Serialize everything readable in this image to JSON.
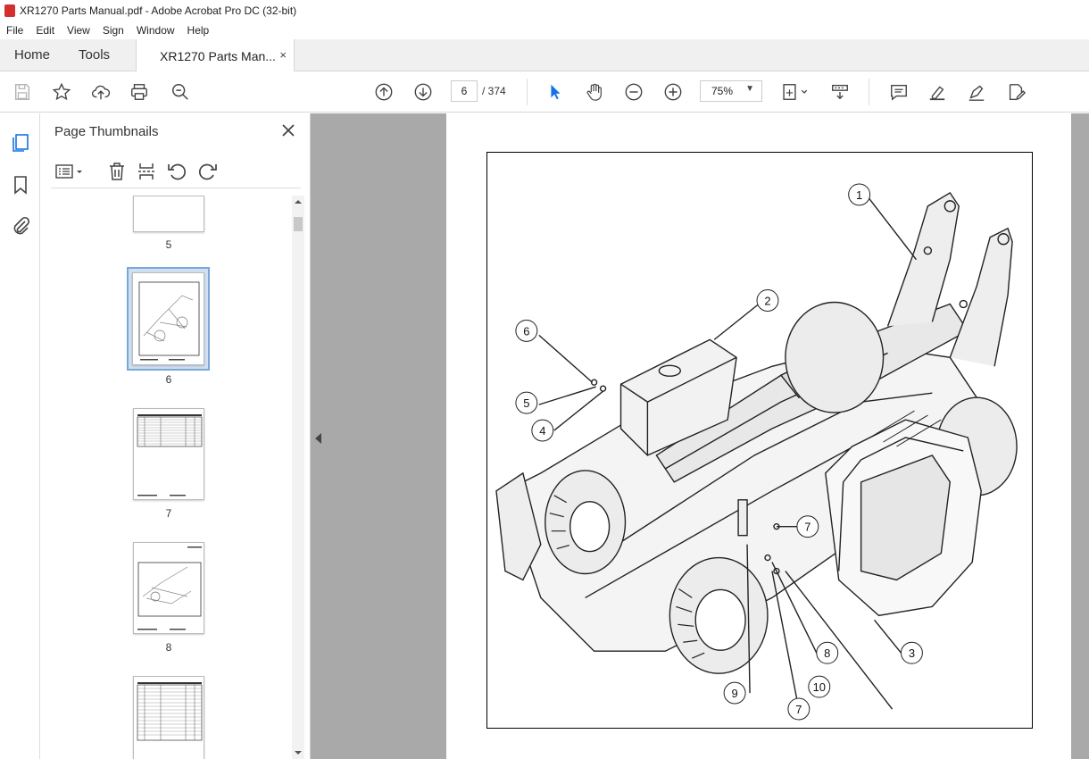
{
  "window": {
    "title": "XR1270 Parts Manual.pdf - Adobe Acrobat Pro DC (32-bit)"
  },
  "menu": [
    "File",
    "Edit",
    "View",
    "Sign",
    "Window",
    "Help"
  ],
  "tabs": {
    "home": "Home",
    "tools": "Tools",
    "document": "XR1270 Parts Man...",
    "close": "×"
  },
  "toolbar": {
    "page_current": "6",
    "page_total": "/ 374",
    "zoom": "75%"
  },
  "panel": {
    "title": "Page Thumbnails",
    "thumbnails": [
      {
        "label": "5"
      },
      {
        "label": "6",
        "selected": true
      },
      {
        "label": "7"
      },
      {
        "label": "8"
      }
    ]
  },
  "diagram": {
    "callouts": [
      "1",
      "2",
      "3",
      "4",
      "5",
      "6",
      "7",
      "8",
      "9",
      "10",
      "7"
    ]
  },
  "icons": {
    "save": "save-icon",
    "bookmark": "star-icon",
    "upload": "upload-icon",
    "print": "print-icon",
    "search": "zoom-search-icon",
    "prev": "prev-page-icon",
    "next": "next-page-icon",
    "select": "cursor-icon",
    "hand": "hand-icon",
    "zoom_out": "zoom-out-icon",
    "zoom_in": "zoom-in-icon",
    "fit": "fit-page-icon",
    "scroll": "scroll-mode-icon",
    "comment": "comment-icon",
    "highlight": "highlight-icon",
    "sign": "sign-icon",
    "edit": "edit-pdf-icon"
  },
  "colors": {
    "accent": "#1473e6",
    "selection": "#7aa7d8",
    "canvas": "#a9a9a9"
  }
}
